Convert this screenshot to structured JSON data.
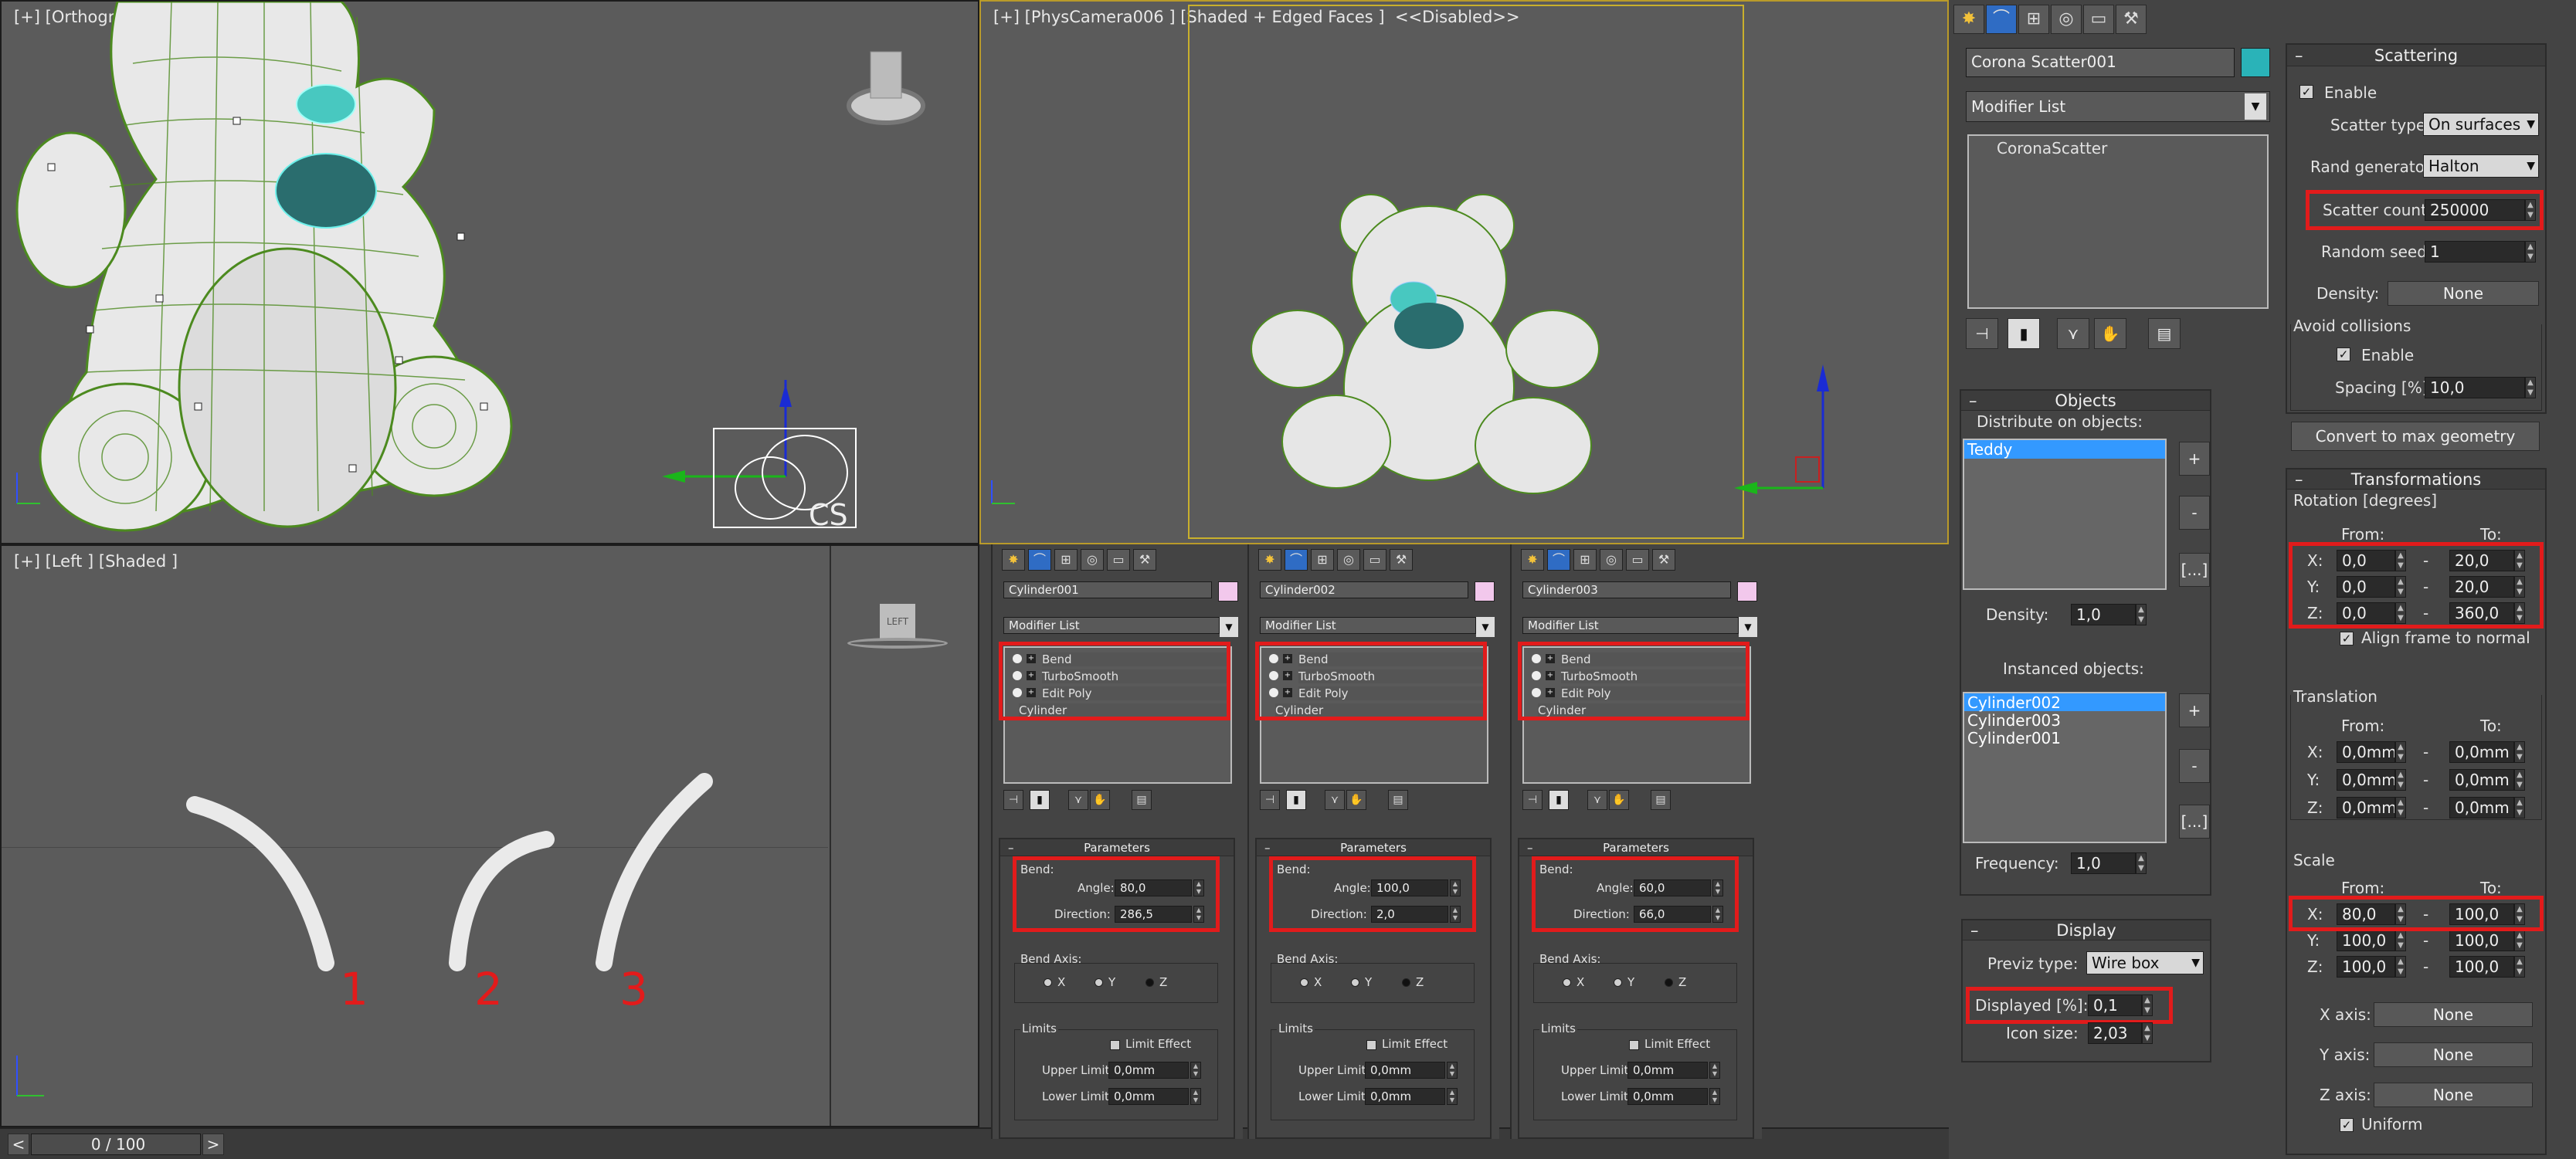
{
  "viewports": {
    "top_left": {
      "label": "[+] [Orthographic"
    },
    "top_right": {
      "label": "[+] [PhysCamera006 ] [Shaded + Edged Faces ]  <<Disabled>>"
    },
    "bottom_left": {
      "label": "[+] [Left ] [Shaded ]",
      "numbers": [
        "1",
        "2",
        "3"
      ]
    },
    "viewcube": "LEFT",
    "cs_label": "CS"
  },
  "timeline": {
    "value": "0 / 100",
    "prev": "<",
    "next": ">"
  },
  "modifier_panels": [
    {
      "name": "Cylinder001",
      "list_label": "Modifier List",
      "stack": [
        "Bend",
        "TurboSmooth",
        "Edit Poly",
        "Cylinder"
      ],
      "params_title": "Parameters",
      "bend": "Bend:",
      "angle_label": "Angle:",
      "angle": "80,0",
      "direction_label": "Direction:",
      "direction": "286,5",
      "bend_axis": "Bend Axis:",
      "axes": [
        "X",
        "Y",
        "Z"
      ],
      "limits": "Limits",
      "limit_effect": "Limit Effect",
      "upper_label": "Upper Limit:",
      "upper": "0,0mm",
      "lower_label": "Lower Limit:",
      "lower": "0,0mm"
    },
    {
      "name": "Cylinder002",
      "list_label": "Modifier List",
      "stack": [
        "Bend",
        "TurboSmooth",
        "Edit Poly",
        "Cylinder"
      ],
      "params_title": "Parameters",
      "bend": "Bend:",
      "angle_label": "Angle:",
      "angle": "100,0",
      "direction_label": "Direction:",
      "direction": "2,0",
      "bend_axis": "Bend Axis:",
      "axes": [
        "X",
        "Y",
        "Z"
      ],
      "limits": "Limits",
      "limit_effect": "Limit Effect",
      "upper_label": "Upper Limit:",
      "upper": "0,0mm",
      "lower_label": "Lower Limit:",
      "lower": "0,0mm"
    },
    {
      "name": "Cylinder003",
      "list_label": "Modifier List",
      "stack": [
        "Bend",
        "TurboSmooth",
        "Edit Poly",
        "Cylinder"
      ],
      "params_title": "Parameters",
      "bend": "Bend:",
      "angle_label": "Angle:",
      "angle": "60,0",
      "direction_label": "Direction:",
      "direction": "66,0",
      "bend_axis": "Bend Axis:",
      "axes": [
        "X",
        "Y",
        "Z"
      ],
      "limits": "Limits",
      "limit_effect": "Limit Effect",
      "upper_label": "Upper Limit:",
      "upper": "0,0mm",
      "lower_label": "Lower Limit:",
      "lower": "0,0mm"
    }
  ],
  "main_panel": {
    "object_name": "Corona Scatter001",
    "object_color": "#2ab3b8",
    "modifier_list": "Modifier List",
    "stack_item": "CoronaScatter",
    "objects": {
      "title": "Objects",
      "distribute_label": "Distribute on objects:",
      "distribute_items": [
        "Teddy"
      ],
      "density_label": "Density:",
      "density": "1,0",
      "instanced_label": "Instanced objects:",
      "instanced_items": [
        "Cylinder002",
        "Cylinder003",
        "Cylinder001"
      ],
      "frequency_label": "Frequency:",
      "frequency": "1,0",
      "add": "+",
      "remove": "-",
      "more": "[...]"
    },
    "display": {
      "title": "Display",
      "previz_label": "Previz type:",
      "previz": "Wire box",
      "displayed_label": "Displayed [%]:",
      "displayed": "0,1",
      "icon_label": "Icon size:",
      "icon": "2,03"
    }
  },
  "scattering": {
    "title": "Scattering",
    "enable": "Enable",
    "type_label": "Scatter type:",
    "type": "On surfaces",
    "rand_label": "Rand generator:",
    "rand": "Halton",
    "count_label": "Scatter count:",
    "count": "250000",
    "seed_label": "Random seed:",
    "seed": "1",
    "density_label": "Density:",
    "density": "None",
    "avoid": "Avoid collisions",
    "avoid_enable": "Enable",
    "spacing_label": "Spacing [%]:",
    "spacing": "10,0",
    "convert": "Convert to max geometry"
  },
  "transformations": {
    "title": "Transformations",
    "rotation": "Rotation [degrees]",
    "from": "From:",
    "to": "To:",
    "rot": [
      {
        "axis": "X:",
        "from": "0,0",
        "to": "20,0"
      },
      {
        "axis": "Y:",
        "from": "0,0",
        "to": "20,0"
      },
      {
        "axis": "Z:",
        "from": "0,0",
        "to": "360,0"
      }
    ],
    "align": "Align frame to normal",
    "translation": "Translation",
    "trans": [
      {
        "axis": "X:",
        "from": "0,0mm",
        "to": "0,0mm"
      },
      {
        "axis": "Y:",
        "from": "0,0mm",
        "to": "0,0mm"
      },
      {
        "axis": "Z:",
        "from": "0,0mm",
        "to": "0,0mm"
      }
    ],
    "scale": "Scale",
    "sc": [
      {
        "axis": "X:",
        "from": "80,0",
        "to": "100,0"
      },
      {
        "axis": "Y:",
        "from": "100,0",
        "to": "100,0"
      },
      {
        "axis": "Z:",
        "from": "100,0",
        "to": "100,0"
      }
    ],
    "xaxis_label": "X axis:",
    "xaxis": "None",
    "yaxis_label": "Y axis:",
    "yaxis": "None",
    "zaxis_label": "Z axis:",
    "zaxis": "None",
    "uniform": "Uniform"
  },
  "colors": {
    "highlight": "#e21b1b",
    "wire": "#4c8a1f",
    "selection": "#3399ff"
  }
}
